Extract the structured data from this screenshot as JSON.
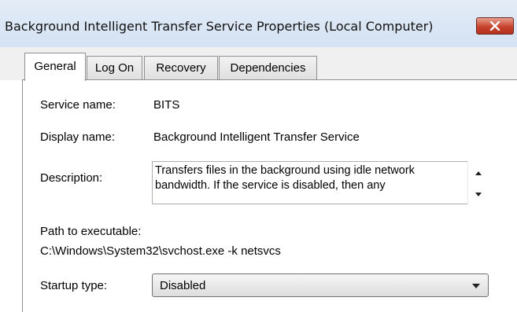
{
  "window": {
    "title": "Background Intelligent Transfer Service Properties (Local Computer)"
  },
  "tabs": [
    {
      "label": "General",
      "active": true
    },
    {
      "label": "Log On",
      "active": false
    },
    {
      "label": "Recovery",
      "active": false
    },
    {
      "label": "Dependencies",
      "active": false
    }
  ],
  "general": {
    "service_name_label": "Service name:",
    "service_name": "BITS",
    "display_name_label": "Display name:",
    "display_name": "Background Intelligent Transfer Service",
    "description_label": "Description:",
    "description": "Transfers files in the background using idle network bandwidth. If the service is disabled, then any",
    "path_label": "Path to executable:",
    "path": "C:\\Windows\\System32\\svchost.exe -k netsvcs",
    "startup_type_label": "Startup type:",
    "startup_type": "Disabled"
  },
  "icons": {
    "close": "close-icon",
    "scroll_up": "scroll-up-arrow-icon",
    "scroll_down": "scroll-down-arrow-icon",
    "dropdown": "chevron-down-icon"
  },
  "colors": {
    "titlebar": "#dbe6f4",
    "close_button": "#c8432e",
    "tabstrip": "#f0f0f0"
  }
}
